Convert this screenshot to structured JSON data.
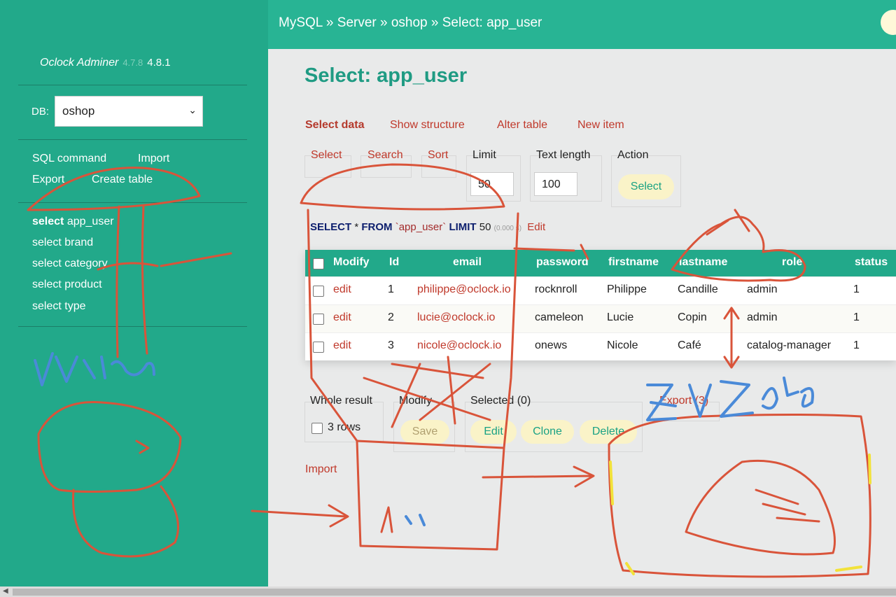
{
  "sidebar": {
    "brand": "Oclock Adminer",
    "brand_old_version": "4.7.8",
    "version": "4.8.1",
    "db_label": "DB:",
    "db_selected": "oshop",
    "links": {
      "sql_command": "SQL command",
      "import": "Import",
      "export": "Export",
      "create_table": "Create table"
    },
    "tables": [
      {
        "action": "select",
        "name": "app_user"
      },
      {
        "action": "select",
        "name": "brand"
      },
      {
        "action": "select",
        "name": "category"
      },
      {
        "action": "select",
        "name": "product"
      },
      {
        "action": "select",
        "name": "type"
      }
    ]
  },
  "header": {
    "breadcrumb": "MySQL » Server » oshop » Select: app_user"
  },
  "main": {
    "title": "Select: app_user",
    "tabs": [
      "Select data",
      "Show structure",
      "Alter table",
      "New item"
    ],
    "filters": {
      "select": "Select",
      "search": "Search",
      "sort": "Sort",
      "limit_label": "Limit",
      "limit_value": "50",
      "text_length_label": "Text length",
      "text_length_value": "100",
      "action_label": "Action",
      "action_button": "Select"
    },
    "sql": {
      "select": "SELECT",
      "star": "*",
      "from": "FROM",
      "table": "`app_user`",
      "limit": "LIMIT",
      "limit_value": "50",
      "time": "(0.000 s)",
      "edit": "Edit"
    },
    "table": {
      "columns": [
        "Modify",
        "Id",
        "email",
        "password",
        "firstname",
        "lastname",
        "role",
        "status"
      ],
      "rows": [
        {
          "edit": "edit",
          "id": "1",
          "email": "philippe@oclock.io",
          "password": "rocknroll",
          "firstname": "Philippe",
          "lastname": "Candille",
          "role": "admin",
          "status": "1"
        },
        {
          "edit": "edit",
          "id": "2",
          "email": "lucie@oclock.io",
          "password": "cameleon",
          "firstname": "Lucie",
          "lastname": "Copin",
          "role": "admin",
          "status": "1"
        },
        {
          "edit": "edit",
          "id": "3",
          "email": "nicole@oclock.io",
          "password": "onews",
          "firstname": "Nicole",
          "lastname": "Café",
          "role": "catalog-manager",
          "status": "1"
        }
      ]
    },
    "bottom": {
      "whole_result": "Whole result",
      "rows": "3 rows",
      "modify": "Modify",
      "save": "Save",
      "selected": "Selected (0)",
      "edit": "Edit",
      "clone": "Clone",
      "delete": "Delete",
      "export": "Export (3)",
      "import": "Import"
    },
    "handwriting": "ZX V Z 948"
  },
  "colors": {
    "accent": "#22a98a",
    "header": "#28b494",
    "link": "#c0392b",
    "button_bg": "#faf3c8",
    "scribble_red": "#d9543a",
    "scribble_blue": "#4a8ad8",
    "scribble_yellow": "#f2e23a"
  }
}
